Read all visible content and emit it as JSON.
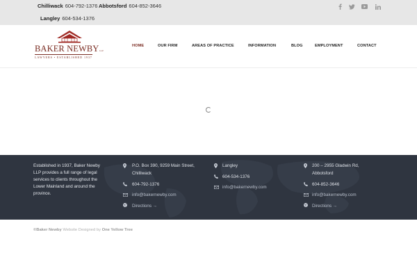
{
  "topbar": {
    "phones": [
      {
        "city": "Chilliwack",
        "number": "604-792-1376"
      },
      {
        "city": "Abbotsford",
        "number": "604-852-3646"
      },
      {
        "city": "Langley",
        "number": "604-534-1376"
      }
    ],
    "social_icons": [
      "facebook-icon",
      "twitter-icon",
      "youtube-icon",
      "linkedin-icon"
    ]
  },
  "header": {
    "logo_name": "BAKER NEWBY",
    "logo_llp": "LLP",
    "logo_tagline": "LAWYERS • ESTABLISHED 1937",
    "nav": [
      "HOME",
      "OUR FIRM",
      "AREAS OF PRACTICE",
      "INFORMATION",
      "BLOG",
      "EMPLOYMENT",
      "CONTACT"
    ],
    "active_nav": "HOME"
  },
  "footer": {
    "about": "Established in 1937, Baker Newby LLP provides a full range of legal services to clients throughout the Lower Mainland and around the province.",
    "col1": {
      "address_line1": "P.O. Box 390, 9259 Main Street,",
      "address_line2": "Chilliwack",
      "phone": "604-792-1376",
      "email": "info@bakernewby.com",
      "directions": "Directions →"
    },
    "col2": {
      "address": "Langley",
      "phone": "604-534-1376",
      "email": "info@bakernewby.com"
    },
    "col3": {
      "address_line1": "200 – 2955 Gladwin Rd,",
      "address_line2": "Abbotsford",
      "phone": "604-852-3646",
      "email": "info@bakernewby.com",
      "directions": "Directions →"
    },
    "colors": {
      "background": "#2f3540",
      "brand": "#7a2c22"
    }
  },
  "copyright": {
    "owner": "©Baker Newby",
    "designed_by_label": "Website Designed by",
    "designer": "One Yellow Tree"
  }
}
